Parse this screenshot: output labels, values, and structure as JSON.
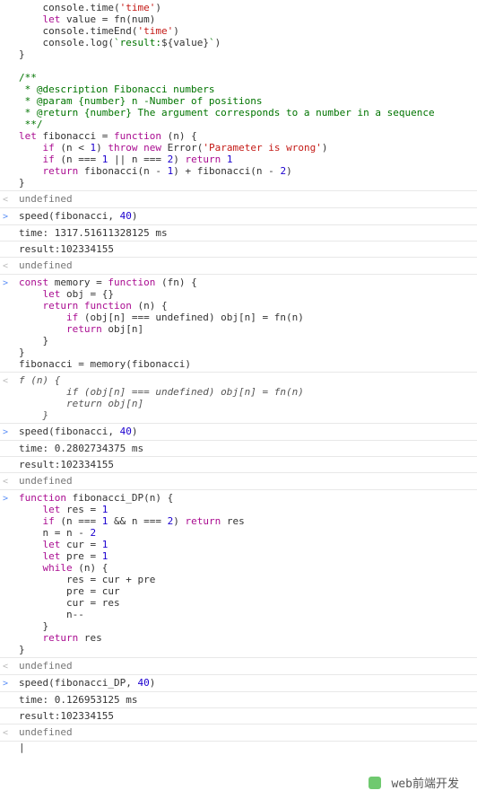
{
  "rows": [
    {
      "prompt": " ",
      "tokens": [
        [
          "    console",
          null
        ],
        [
          ".",
          null
        ],
        [
          "time",
          null
        ],
        [
          "(",
          null
        ],
        [
          "'time'",
          "str"
        ],
        [
          ")",
          null
        ],
        [
          "\n",
          null
        ],
        [
          "    ",
          null
        ],
        [
          "let",
          "kw"
        ],
        [
          " value = fn(num)\n",
          null
        ],
        [
          "    console.",
          null
        ],
        [
          "timeEnd",
          null
        ],
        [
          "(",
          null
        ],
        [
          "'time'",
          "str"
        ],
        [
          ")\n",
          null
        ],
        [
          "    console.",
          null
        ],
        [
          "log",
          null
        ],
        [
          "(",
          null
        ],
        [
          "`result:",
          "tmpl"
        ],
        [
          "${",
          null
        ],
        [
          "value",
          null
        ],
        [
          "}",
          null
        ],
        [
          "`",
          "tmpl"
        ],
        [
          ")\n",
          null
        ],
        [
          "}\n",
          null
        ],
        [
          "\n",
          null
        ],
        [
          "/**",
          "comm"
        ],
        [
          "\n",
          null
        ],
        [
          " * @description Fibonacci numbers",
          "comm"
        ],
        [
          "\n",
          null
        ],
        [
          " * @param {number} n -Number of positions",
          "comm"
        ],
        [
          "\n",
          null
        ],
        [
          " * @return {number} The argument corresponds to a number in a sequence",
          "comm"
        ],
        [
          "\n",
          null
        ],
        [
          " **/",
          "comm"
        ],
        [
          "\n",
          null
        ],
        [
          "let",
          "kw"
        ],
        [
          " fibonacci = ",
          null
        ],
        [
          "function",
          "kw"
        ],
        [
          " (n) {\n",
          null
        ],
        [
          "    ",
          null
        ],
        [
          "if",
          "kw"
        ],
        [
          " (n < ",
          null
        ],
        [
          "1",
          "num"
        ],
        [
          ") ",
          null
        ],
        [
          "throw",
          "kw"
        ],
        [
          " ",
          null
        ],
        [
          "new",
          "kw"
        ],
        [
          " ",
          null
        ],
        [
          "Error",
          null
        ],
        [
          "(",
          null
        ],
        [
          "'Parameter is wrong'",
          "str"
        ],
        [
          ")\n",
          null
        ],
        [
          "    ",
          null
        ],
        [
          "if",
          "kw"
        ],
        [
          " (n === ",
          null
        ],
        [
          "1",
          "num"
        ],
        [
          " || n === ",
          null
        ],
        [
          "2",
          "num"
        ],
        [
          ") ",
          null
        ],
        [
          "return",
          "kw"
        ],
        [
          " ",
          null
        ],
        [
          "1",
          "num"
        ],
        [
          "\n",
          null
        ],
        [
          "    ",
          null
        ],
        [
          "return",
          "kw"
        ],
        [
          " fibonacci(n - ",
          null
        ],
        [
          "1",
          "num"
        ],
        [
          ") + fibonacci(n - ",
          null
        ],
        [
          "2",
          "num"
        ],
        [
          ")\n",
          null
        ],
        [
          "}",
          null
        ]
      ]
    },
    {
      "prompt": "<",
      "tokens": [
        [
          "undefined",
          "undef"
        ]
      ]
    },
    {
      "prompt": ">",
      "tokens": [
        [
          "speed(fibonacci, ",
          null
        ],
        [
          "40",
          "num"
        ],
        [
          ")",
          null
        ]
      ]
    },
    {
      "prompt": " ",
      "tokens": [
        [
          "time: 1317.51611328125 ms",
          null
        ]
      ]
    },
    {
      "prompt": " ",
      "tokens": [
        [
          "result:102334155",
          null
        ]
      ]
    },
    {
      "prompt": "<",
      "tokens": [
        [
          "undefined",
          "undef"
        ]
      ]
    },
    {
      "prompt": ">",
      "tokens": [
        [
          "const",
          "kw"
        ],
        [
          " memory = ",
          null
        ],
        [
          "function",
          "kw"
        ],
        [
          " (fn) {\n",
          null
        ],
        [
          "    ",
          null
        ],
        [
          "let",
          "kw"
        ],
        [
          " obj = {}\n",
          null
        ],
        [
          "    ",
          null
        ],
        [
          "return",
          "kw"
        ],
        [
          " ",
          null
        ],
        [
          "function",
          "kw"
        ],
        [
          " (n) {\n",
          null
        ],
        [
          "        ",
          null
        ],
        [
          "if",
          "kw"
        ],
        [
          " (obj[n] === ",
          null
        ],
        [
          "undefined",
          null
        ],
        [
          ") obj[n] = fn(n)\n",
          null
        ],
        [
          "        ",
          null
        ],
        [
          "return",
          "kw"
        ],
        [
          " obj[n]\n",
          null
        ],
        [
          "    }\n",
          null
        ],
        [
          "}\n",
          null
        ],
        [
          "fibonacci = memory(fibonacci)",
          null
        ]
      ]
    },
    {
      "prompt": "<",
      "tokens": [
        [
          "f (n) {",
          "fnbody"
        ],
        [
          "\n",
          null
        ],
        [
          "        if (obj[n] === undefined) obj[n] = fn(n)",
          "fnbody"
        ],
        [
          "\n",
          null
        ],
        [
          "        return obj[n]",
          "fnbody"
        ],
        [
          "\n",
          null
        ],
        [
          "    }",
          "fnbody"
        ]
      ]
    },
    {
      "prompt": ">",
      "tokens": [
        [
          "speed(fibonacci, ",
          null
        ],
        [
          "40",
          "num"
        ],
        [
          ")",
          null
        ]
      ]
    },
    {
      "prompt": " ",
      "tokens": [
        [
          "time: 0.2802734375 ms",
          null
        ]
      ]
    },
    {
      "prompt": " ",
      "tokens": [
        [
          "result:102334155",
          null
        ]
      ]
    },
    {
      "prompt": "<",
      "tokens": [
        [
          "undefined",
          "undef"
        ]
      ]
    },
    {
      "prompt": ">",
      "tokens": [
        [
          "function",
          "kw"
        ],
        [
          " fibonacci_DP(n) {\n",
          null
        ],
        [
          "    ",
          null
        ],
        [
          "let",
          "kw"
        ],
        [
          " res = ",
          null
        ],
        [
          "1",
          "num"
        ],
        [
          "\n",
          null
        ],
        [
          "    ",
          null
        ],
        [
          "if",
          "kw"
        ],
        [
          " (n === ",
          null
        ],
        [
          "1",
          "num"
        ],
        [
          " && n === ",
          null
        ],
        [
          "2",
          "num"
        ],
        [
          ") ",
          null
        ],
        [
          "return",
          "kw"
        ],
        [
          " res\n",
          null
        ],
        [
          "    n = n - ",
          null
        ],
        [
          "2",
          "num"
        ],
        [
          "\n",
          null
        ],
        [
          "    ",
          null
        ],
        [
          "let",
          "kw"
        ],
        [
          " cur = ",
          null
        ],
        [
          "1",
          "num"
        ],
        [
          "\n",
          null
        ],
        [
          "    ",
          null
        ],
        [
          "let",
          "kw"
        ],
        [
          " pre = ",
          null
        ],
        [
          "1",
          "num"
        ],
        [
          "\n",
          null
        ],
        [
          "    ",
          null
        ],
        [
          "while",
          "kw"
        ],
        [
          " (n) {\n",
          null
        ],
        [
          "        res = cur + pre\n",
          null
        ],
        [
          "        pre = cur\n",
          null
        ],
        [
          "        cur = res\n",
          null
        ],
        [
          "        n--\n",
          null
        ],
        [
          "    }\n",
          null
        ],
        [
          "    ",
          null
        ],
        [
          "return",
          "kw"
        ],
        [
          " res\n",
          null
        ],
        [
          "}",
          null
        ]
      ]
    },
    {
      "prompt": "<",
      "tokens": [
        [
          "undefined",
          "undef"
        ]
      ]
    },
    {
      "prompt": ">",
      "tokens": [
        [
          "speed(fibonacci_DP, ",
          null
        ],
        [
          "40",
          "num"
        ],
        [
          ")",
          null
        ]
      ]
    },
    {
      "prompt": " ",
      "tokens": [
        [
          "time: 0.126953125 ms",
          null
        ]
      ]
    },
    {
      "prompt": " ",
      "tokens": [
        [
          "result:102334155",
          null
        ]
      ]
    },
    {
      "prompt": "<",
      "tokens": [
        [
          "undefined",
          "undef"
        ]
      ]
    }
  ],
  "watermark": "web前端开发",
  "cursor": "|"
}
